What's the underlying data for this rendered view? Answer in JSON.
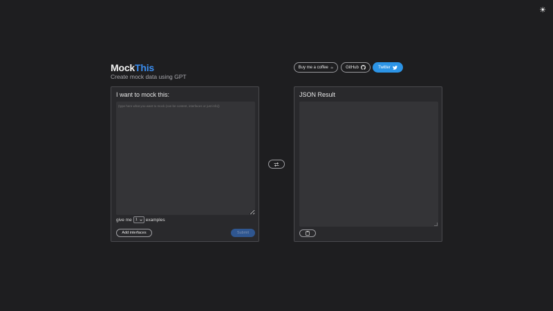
{
  "theme_toggle": {
    "icon": "sun-icon",
    "glyph": "☀"
  },
  "brand": {
    "name_part1": "Mock",
    "name_part2": "This",
    "accent": "#3b8ef0",
    "tagline": "Create mock data using GPT"
  },
  "header_links": {
    "coffee_label": "Buy me a coffee",
    "coffee_icon": "☕",
    "github_label": "GitHub",
    "twitter_label": "Twitter",
    "twitter_color": "#2c94e6"
  },
  "input_panel": {
    "title": "I want to mock this:",
    "placeholder": "(type here what you want to mock (can be content, interfaces or just info))",
    "count_prefix": "give me",
    "count_value": "1",
    "count_suffix": "examples",
    "add_interfaces_label": "Add interfaces",
    "submit_label": "Submit"
  },
  "result_panel": {
    "title": "JSON Result",
    "copy_icon": "clipboard-icon"
  },
  "swap": {
    "icon": "swap-arrows-icon"
  }
}
